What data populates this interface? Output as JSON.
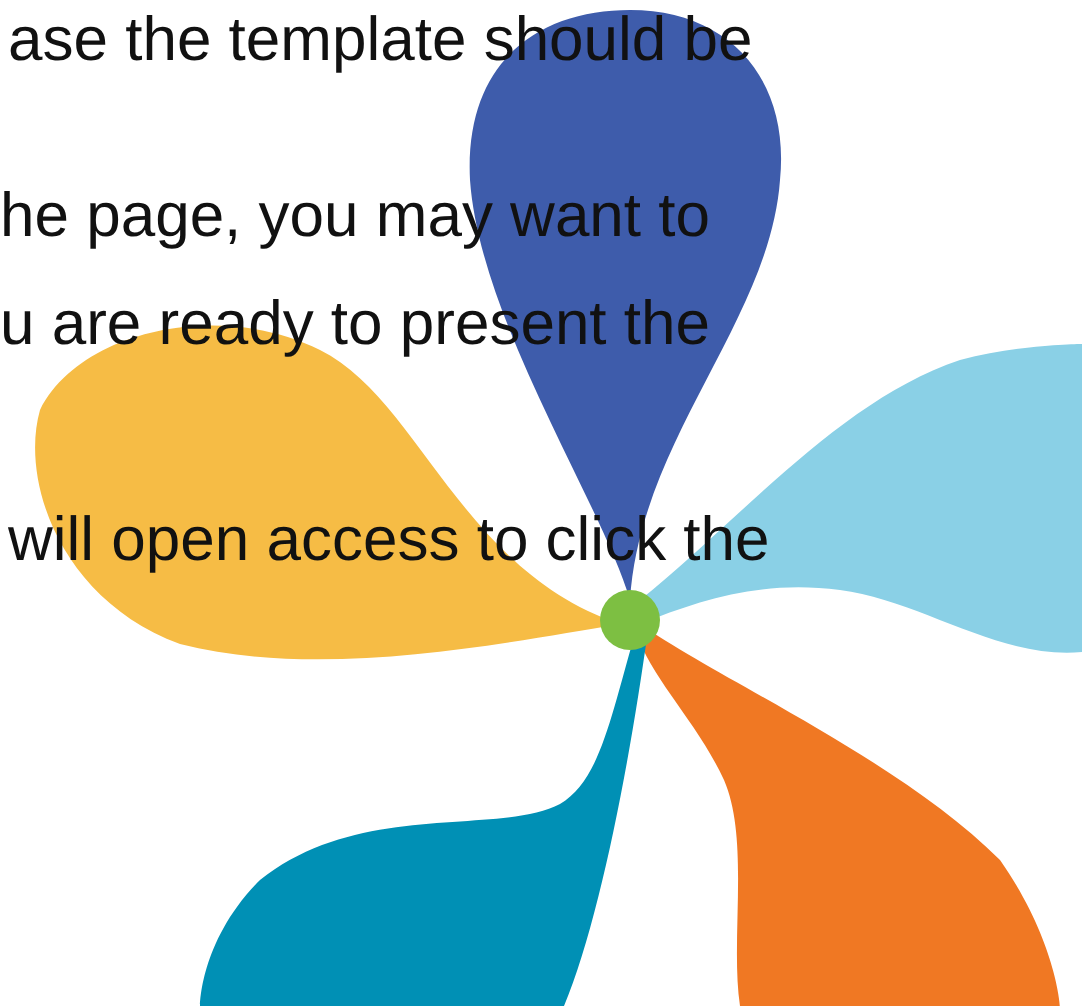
{
  "text_lines": [
    {
      "text": "ase the template should be"
    },
    {
      "text": "he page, you may want to"
    },
    {
      "text": "u are ready to present the"
    },
    {
      "text": "will open access to click the"
    }
  ]
}
